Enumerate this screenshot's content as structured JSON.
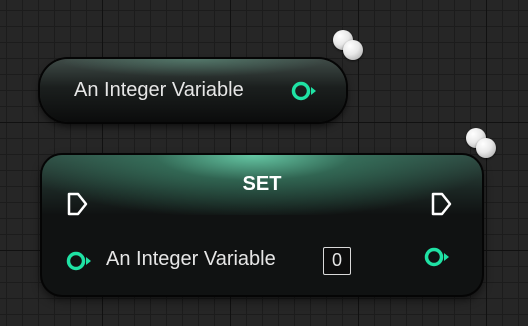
{
  "getter_node": {
    "label": "An Integer Variable",
    "output_pin_icon": "integer-pin-icon"
  },
  "set_node": {
    "title": "SET",
    "exec_in_icon": "exec-pin-icon",
    "exec_out_icon": "exec-pin-icon",
    "variable_label": "An Integer Variable",
    "value": "0",
    "input_pin_icon": "integer-pin-icon",
    "output_pin_icon": "integer-pin-icon"
  },
  "colors": {
    "integer_pin": "#1fe2a4",
    "exec_pin": "#ffffff",
    "header_glow": "#6edcb4",
    "grid_background": "#262626"
  }
}
